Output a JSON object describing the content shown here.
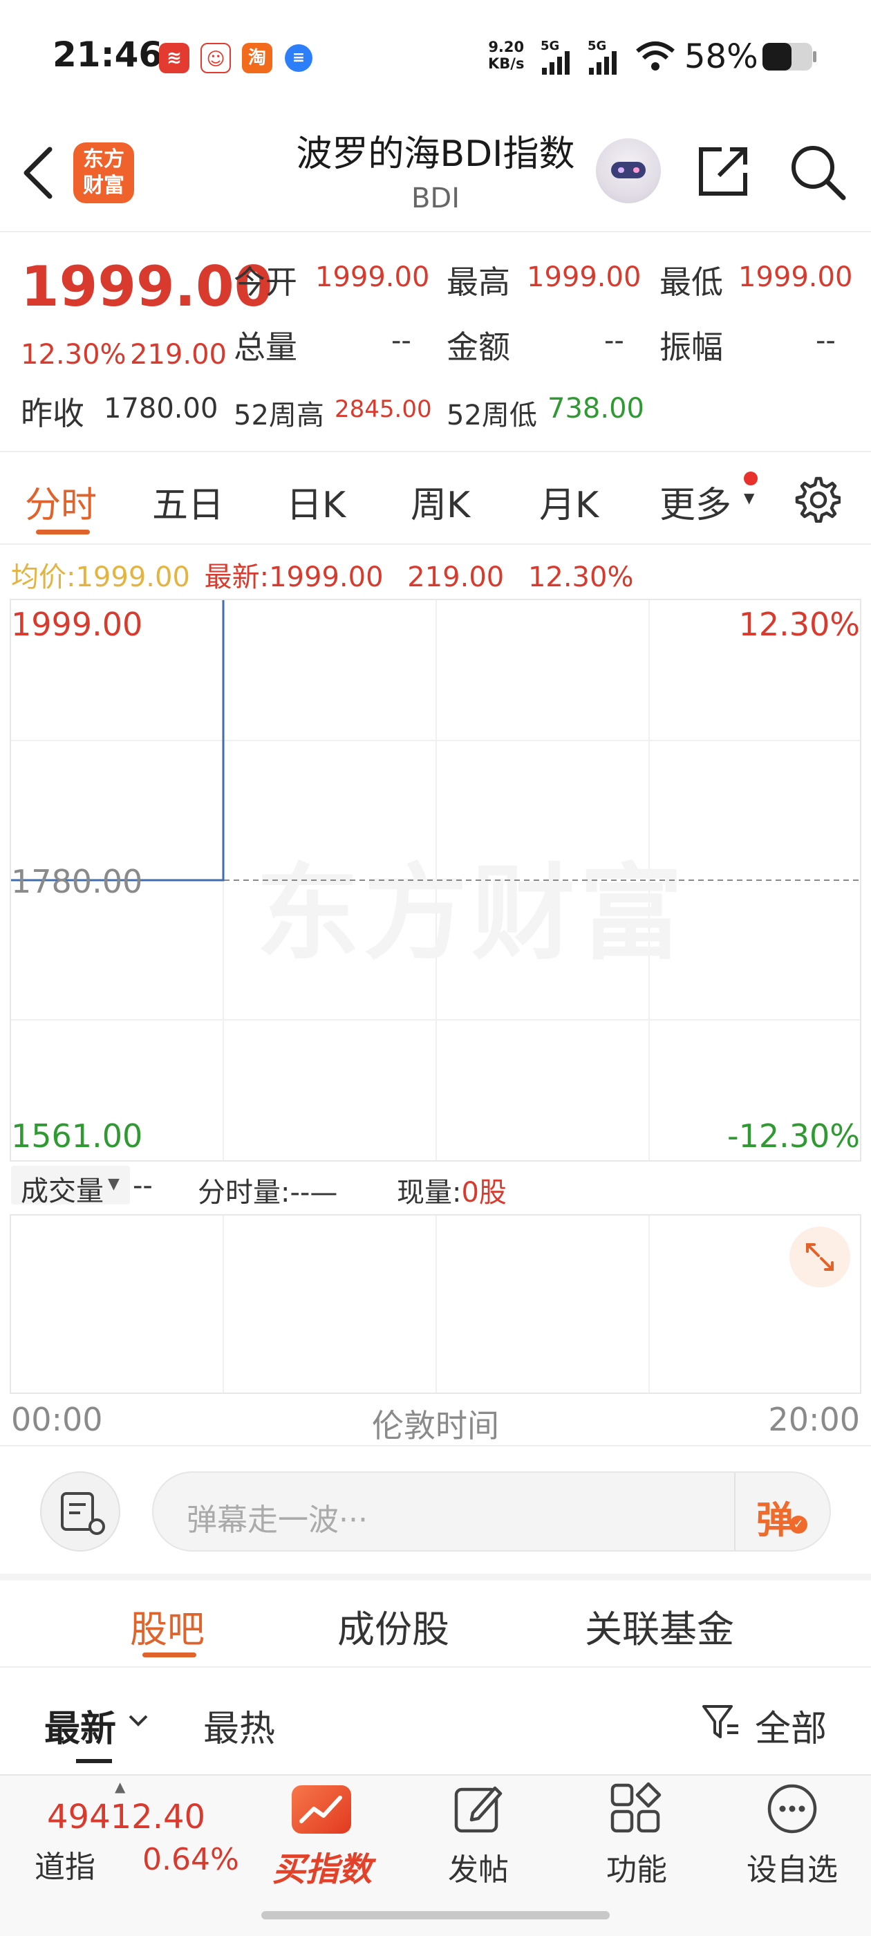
{
  "status_bar": {
    "time": "21:46",
    "net_speed_value": "9.20",
    "net_speed_unit": "KB/s",
    "signal_1": "5G",
    "signal_2": "5G",
    "battery": "58%"
  },
  "header": {
    "logo_line1": "东方",
    "logo_line2": "财富",
    "title": "波罗的海BDI指数",
    "subtitle": "BDI"
  },
  "quote": {
    "price": "1999.00",
    "change_pct": "12.30%",
    "change_amt": "219.00",
    "open_label": "今开",
    "open": "1999.00",
    "high_label": "最高",
    "high": "1999.00",
    "low_label": "最低",
    "low": "1999.00",
    "volume_label": "总量",
    "volume": "--",
    "amount_label": "金额",
    "amount": "--",
    "amplitude_label": "振幅",
    "amplitude": "--",
    "prev_close_label": "昨收",
    "prev_close": "1780.00",
    "w52_high_label": "52周高",
    "w52_high": "2845.00",
    "w52_low_label": "52周低",
    "w52_low": "738.00"
  },
  "chart_tabs": [
    "分时",
    "五日",
    "日K",
    "周K",
    "月K",
    "更多"
  ],
  "info_line": {
    "avg_label": "均价:",
    "avg_value": "1999.00",
    "latest_label": "最新:",
    "latest_value": "1999.00",
    "latest_change": "219.00",
    "latest_pct": "12.30%"
  },
  "chart_data": {
    "type": "line",
    "x": [
      "00:00",
      "05:00"
    ],
    "series": [
      {
        "values": [
          1780.0,
          1999.0
        ]
      }
    ],
    "ylim": [
      1561.0,
      1999.0
    ],
    "y_labels_left": [
      "1999.00",
      "1780.00",
      "1561.00"
    ],
    "y_labels_right": [
      "12.30%",
      "-12.30%"
    ],
    "reference_line": 1780.0,
    "x_tick_labels": [
      "00:00",
      "20:00"
    ],
    "xlabel": "伦敦时间",
    "watermark": "东方财富",
    "colors": {
      "line": "#3f6db0",
      "up": "#d93a2e",
      "down": "#2f9a32"
    }
  },
  "volume_panel": {
    "selector": "成交量",
    "selector_value": "--",
    "minute_vol_label": "分时量:",
    "minute_vol_value": "--—",
    "current_vol_label": "现量:",
    "current_vol_value": "0股"
  },
  "comment_bar": {
    "placeholder": "弹幕走一波···",
    "send_label": "弹"
  },
  "section_tabs": [
    "股吧",
    "成份股",
    "关联基金"
  ],
  "feed_filter": {
    "latest": "最新",
    "hot": "最热",
    "all": "全部"
  },
  "bottom_bar": {
    "index_value": "49412.40",
    "index_name": "道指",
    "index_pct": "0.64%",
    "buy_index": "买指数",
    "post": "发帖",
    "functions": "功能",
    "add_watch": "设自选"
  },
  "colors": {
    "accent": "#e0632c",
    "up": "#d93a2e",
    "down": "#2f9a32",
    "avg": "#e4b440"
  }
}
